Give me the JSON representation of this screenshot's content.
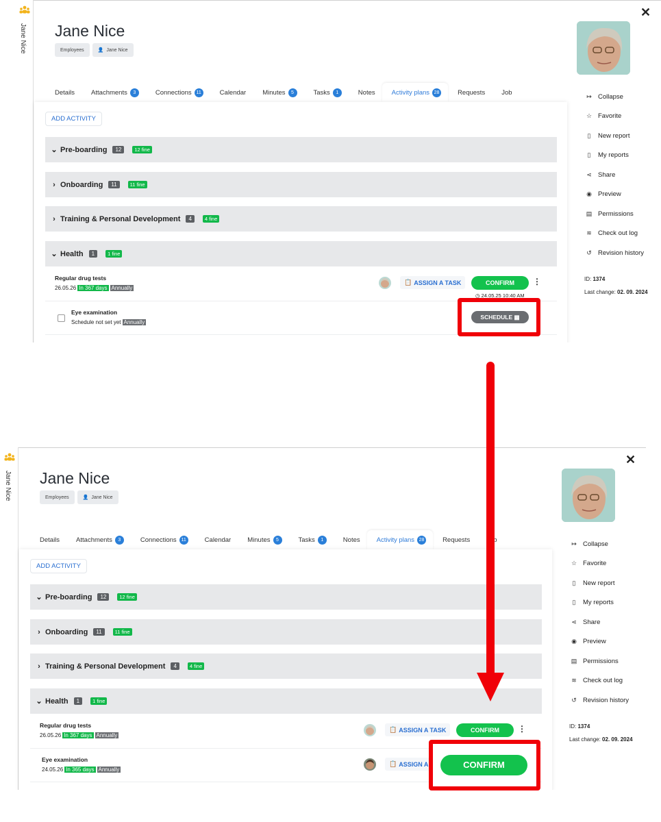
{
  "person": {
    "name": "Jane Nice",
    "rail_label": "Jane Nice",
    "chips": [
      "Employees",
      "Jane Nice"
    ]
  },
  "tabs": [
    {
      "label": "Details",
      "badge": ""
    },
    {
      "label": "Attachments",
      "badge": "3"
    },
    {
      "label": "Connections",
      "badge": "11"
    },
    {
      "label": "Calendar",
      "badge": ""
    },
    {
      "label": "Minutes",
      "badge": "5"
    },
    {
      "label": "Tasks",
      "badge": "1"
    },
    {
      "label": "Notes",
      "badge": ""
    },
    {
      "label": "Activity plans",
      "badge": "28"
    },
    {
      "label": "Requests",
      "badge": ""
    },
    {
      "label": "Job",
      "badge": ""
    }
  ],
  "add_activity": "ADD ACTIVITY",
  "sections": [
    {
      "label": "Pre-boarding",
      "count": "12",
      "fine": "12 fine",
      "expanded": true
    },
    {
      "label": "Onboarding",
      "count": "11",
      "fine": "11 fine",
      "expanded": false
    },
    {
      "label": "Training & Personal Development",
      "count": "4",
      "fine": "4 fine",
      "expanded": false
    },
    {
      "label": "Health",
      "count": "1",
      "fine": "1 fine",
      "expanded": true
    }
  ],
  "rows_before": {
    "drug": {
      "title": "Regular drug tests",
      "date": "26.05.26",
      "days": "In 367 days",
      "freq": "Annually",
      "assign": "ASSIGN A TASK",
      "confirm": "CONFIRM",
      "timestamp": "24.05.25 10:40 AM"
    },
    "eye": {
      "title": "Eye examination",
      "sub": "Schedule not set yet",
      "freq": "Annually",
      "schedule": "SCHEDULE"
    }
  },
  "rows_after": {
    "drug": {
      "title": "Regular drug tests",
      "date": "26.05.26",
      "days": "In 367 days",
      "freq": "Annually",
      "assign": "ASSIGN A TASK",
      "confirm": "CONFIRM"
    },
    "eye": {
      "title": "Eye examination",
      "date": "24.05.26",
      "days": "In 365 days",
      "freq": "Annually",
      "assign": "ASSIGN A T",
      "confirm": "CONFIRM"
    }
  },
  "right_menu": [
    {
      "label": "Collapse",
      "icon": "collapse-icon"
    },
    {
      "label": "Favorite",
      "icon": "star-icon"
    },
    {
      "label": "New report",
      "icon": "new-report-icon"
    },
    {
      "label": "My reports",
      "icon": "reports-icon"
    },
    {
      "label": "Share",
      "icon": "share-icon"
    },
    {
      "label": "Preview",
      "icon": "eye-icon"
    },
    {
      "label": "Permissions",
      "icon": "permissions-icon"
    },
    {
      "label": "Check out log",
      "icon": "log-icon"
    },
    {
      "label": "Revision history",
      "icon": "history-icon"
    }
  ],
  "meta": {
    "id_label": "ID:",
    "id_value": "1374",
    "change_label": "Last change:",
    "change_value": "02. 09. 2024"
  },
  "colors": {
    "accent": "#2a7fd9",
    "green": "#13c24d",
    "highlight": "#f00008",
    "section_bg": "#e7e8ea"
  }
}
